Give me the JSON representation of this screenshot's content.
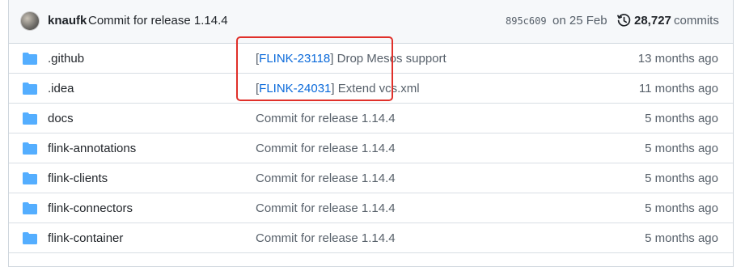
{
  "latest_commit": {
    "author": "knaufk",
    "message": "Commit for release 1.14.4",
    "sha": "895c609",
    "date": "on 25 Feb",
    "commits_count": "28,727",
    "commits_label": "commits"
  },
  "files": [
    {
      "name": ".github",
      "issue": "FLINK-23118",
      "message": "] Drop Mesos support",
      "age": "13 months ago"
    },
    {
      "name": ".idea",
      "issue": "FLINK-24031",
      "message": "] Extend vcs.xml",
      "age": "11 months ago"
    },
    {
      "name": "docs",
      "message": "Commit for release 1.14.4",
      "age": "5 months ago"
    },
    {
      "name": "flink-annotations",
      "message": "Commit for release 1.14.4",
      "age": "5 months ago"
    },
    {
      "name": "flink-clients",
      "message": "Commit for release 1.14.4",
      "age": "5 months ago"
    },
    {
      "name": "flink-connectors",
      "message": "Commit for release 1.14.4",
      "age": "5 months ago"
    },
    {
      "name": "flink-container",
      "message": "Commit for release 1.14.4",
      "age": "5 months ago"
    }
  ],
  "colors": {
    "folder": "#54aeff",
    "link": "#0969da",
    "highlight": "#e0302a"
  },
  "icons": {
    "folder": "folder-icon",
    "history": "history-icon"
  }
}
